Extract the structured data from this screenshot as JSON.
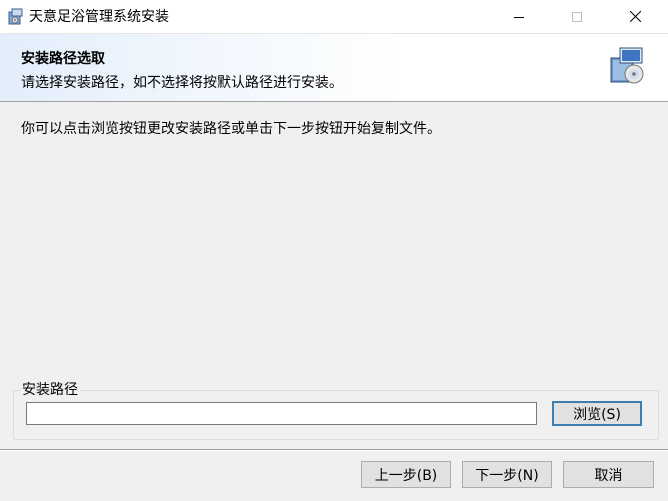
{
  "window": {
    "title": "天意足浴管理系统安装",
    "app_icon": "installer-icon",
    "controls": [
      "minimize-icon",
      "maximize-icon",
      "close-icon"
    ]
  },
  "banner": {
    "title": "安装路径选取",
    "subtitle": "请选择安装路径，如不选择将按默认路径进行安装。",
    "icon": "installer-package-icon"
  },
  "content": {
    "instruction": "你可以点击浏览按钮更改安装路径或单击下一步按钮开始复制文件。"
  },
  "install_path": {
    "group_label": "安装路径",
    "value": "",
    "browse_label": "浏览(S)"
  },
  "footer": {
    "back_label": "上一步(B)",
    "next_label": "下一步(N)",
    "cancel_label": "取消"
  },
  "colors": {
    "default_button_border": "#3c7fb1",
    "banner_gradient_start": "#e3eefb",
    "button_face": "#e1e1e1"
  }
}
